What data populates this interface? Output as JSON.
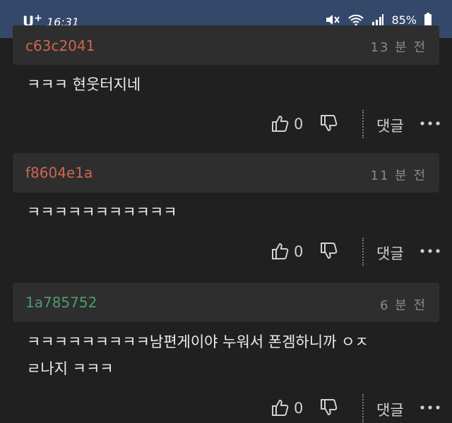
{
  "status_bar": {
    "carrier": "U",
    "carrier_plus": "+",
    "time": "16:31",
    "battery": "85%"
  },
  "comments": [
    {
      "user": "c63c2041",
      "user_color": "#d0654e",
      "time": "13 분 전",
      "text": "ㅋㅋㅋ 현웃터지네",
      "likes": "0",
      "reply_label": "댓글"
    },
    {
      "user": "f8604e1a",
      "user_color": "#d0654e",
      "time": "11 분 전",
      "text": "ㅋㅋㅋㅋㅋㅋㅋㅋㅋㅋㅋ",
      "likes": "0",
      "reply_label": "댓글"
    },
    {
      "user": "1a785752",
      "user_color": "#4f9a6e",
      "time": "6 분 전",
      "text": "ㅋㅋㅋㅋㅋㅋㅋㅋㅋ남편게이야 누워서 폰겜하니까 ㅇㅈㄹ나지 ㅋㅋㅋ",
      "likes": "0",
      "reply_label": "댓글"
    }
  ]
}
